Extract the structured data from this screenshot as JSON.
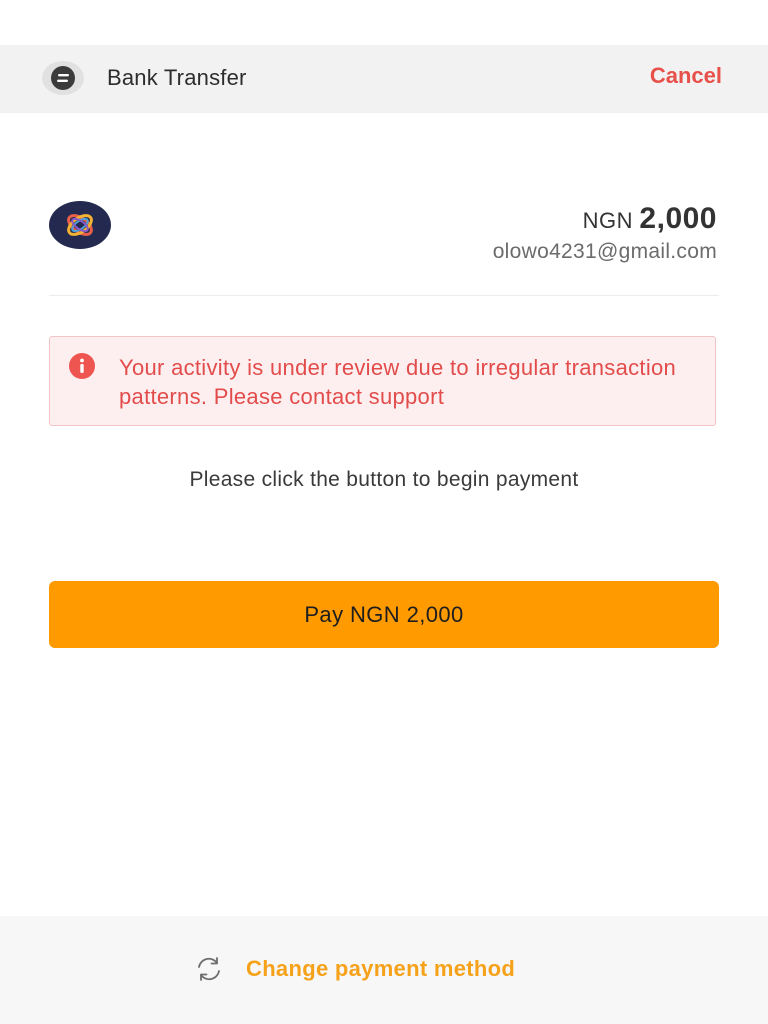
{
  "header": {
    "title": "Bank Transfer",
    "cancel_label": "Cancel",
    "icon": "bank-transfer-icon"
  },
  "payment": {
    "currency": "NGN",
    "amount": "2,000",
    "email": "olowo4231@gmail.com",
    "merchant_logo": "merchant-logo"
  },
  "alert": {
    "icon": "info-icon",
    "message": "Your activity is under review due to irregular transaction patterns. Please contact support"
  },
  "instruction": "Please click the button to begin payment",
  "pay_button_label": "Pay NGN 2,000",
  "footer": {
    "change_label": "Change payment method",
    "icon": "refresh-icon"
  },
  "colors": {
    "accent": "#ff9a00",
    "danger": "#e8504a",
    "link": "#f5a21a"
  }
}
